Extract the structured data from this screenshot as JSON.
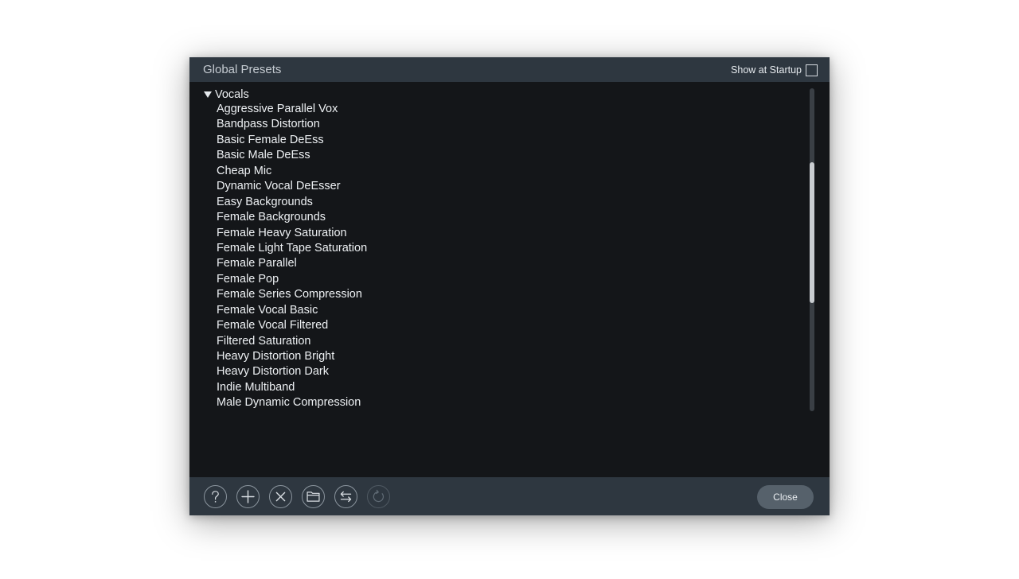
{
  "window": {
    "title": "Global Presets",
    "show_at_startup_label": "Show at Startup",
    "show_at_startup_checked": false
  },
  "preset_list": {
    "group": {
      "name": "Vocals",
      "expanded": true,
      "items": [
        "Aggressive Parallel Vox",
        "Bandpass Distortion",
        "Basic Female DeEss",
        "Basic Male DeEss",
        "Cheap Mic",
        "Dynamic Vocal DeEsser",
        "Easy Backgrounds",
        "Female Backgrounds",
        "Female Heavy Saturation",
        "Female Light Tape Saturation",
        "Female Parallel",
        "Female Pop",
        "Female Series Compression",
        "Female Vocal Basic",
        "Female Vocal Filtered",
        "Filtered Saturation",
        "Heavy Distortion Bright",
        "Heavy Distortion Dark",
        "Indie Multiband",
        "Male Dynamic Compression"
      ]
    }
  },
  "footer": {
    "icons": [
      "help-icon",
      "add-icon",
      "delete-icon",
      "folder-icon",
      "swap-icon",
      "refresh-icon"
    ],
    "close_label": "Close"
  },
  "colors": {
    "titlebar_bg": "#2e3740",
    "list_bg": "#141619",
    "text": "#eef1f4",
    "close_button_bg": "#56616b"
  }
}
